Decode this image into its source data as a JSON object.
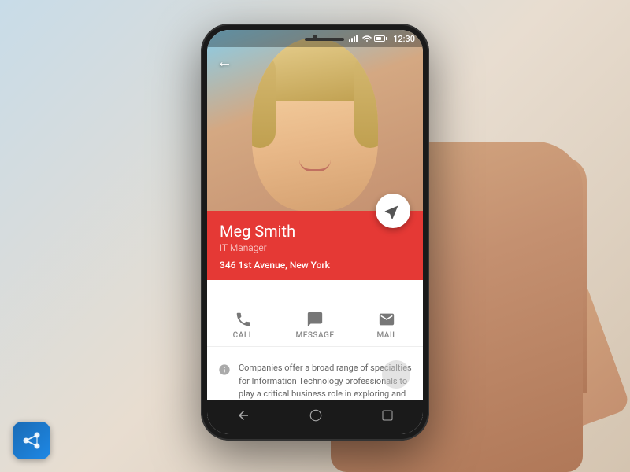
{
  "background": {
    "gradient_start": "#c8dce8",
    "gradient_end": "#d4c4b0"
  },
  "status_bar": {
    "time": "12:30",
    "signal_label": "signal-icon",
    "wifi_label": "wifi-icon",
    "battery_label": "battery-icon"
  },
  "contact": {
    "name": "Meg Smith",
    "title": "IT Manager",
    "address": "346 1st Avenue, New York"
  },
  "actions": [
    {
      "id": "call",
      "label": "CALL",
      "icon": "phone-icon"
    },
    {
      "id": "message",
      "label": "MESSAGE",
      "icon": "message-icon"
    },
    {
      "id": "mail",
      "label": "MAIL",
      "icon": "mail-icon"
    }
  ],
  "description": "Companies offer a broad range of specialties for Information Technology professionals to play a critical business role in exploring and refining information strategies and evaluating new technologies. Their knowledge and",
  "back_button": "←",
  "nav": {
    "back": "◁",
    "home": "○",
    "recent": "□"
  },
  "fab": {
    "icon": "directions-icon"
  }
}
